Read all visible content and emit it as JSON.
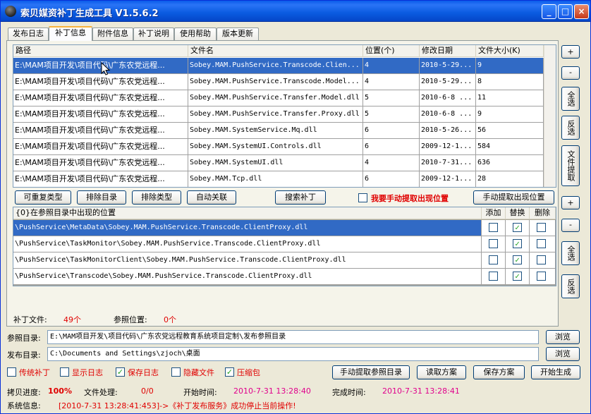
{
  "window": {
    "title": "索贝媒资补丁生成工具 V1.5.6.2",
    "min": "_",
    "max": "□",
    "close": "×"
  },
  "tabs": [
    "发布日志",
    "补丁信息",
    "附件信息",
    "补丁说明",
    "使用帮助",
    "版本更新"
  ],
  "patch_table": {
    "headers": [
      "路径",
      "文件名",
      "位置(个)",
      "修改日期",
      "文件大小(K)"
    ],
    "rows": [
      [
        "E:\\MAM项目开发\\项目代码\\广东农党远程...",
        "Sobey.MAM.PushService.Transcode.Clien...",
        "4",
        "2010-5-29...",
        "9"
      ],
      [
        "E:\\MAM项目开发\\项目代码\\广东农党远程...",
        "Sobey.MAM.PushService.Transcode.Model...",
        "4",
        "2010-5-29...",
        "8"
      ],
      [
        "E:\\MAM项目开发\\项目代码\\广东农党远程...",
        "Sobey.MAM.PushService.Transfer.Model.dll",
        "5",
        "2010-6-8  ...",
        "11"
      ],
      [
        "E:\\MAM项目开发\\项目代码\\广东农党远程...",
        "Sobey.MAM.PushService.Transfer.Proxy.dll",
        "5",
        "2010-6-8  ...",
        "9"
      ],
      [
        "E:\\MAM项目开发\\项目代码\\广东农党远程...",
        "Sobey.MAM.SystemService.Mq.dll",
        "6",
        "2010-5-26...",
        "56"
      ],
      [
        "E:\\MAM项目开发\\项目代码\\广东农党远程...",
        "Sobey.MAM.SystemUI.Controls.dll",
        "6",
        "2009-12-1...",
        "584"
      ],
      [
        "E:\\MAM项目开发\\项目代码\\广东农党远程...",
        "Sobey.MAM.SystemUI.dll",
        "4",
        "2010-7-31...",
        "636"
      ],
      [
        "E:\\MAM项目开发\\项目代码\\广东农党远程...",
        "Sobey.MAM.Tcp.dll",
        "6",
        "2009-12-1...",
        "28"
      ]
    ]
  },
  "right_buttons_top": {
    "plus": "+",
    "minus": "-",
    "select_all": "全选",
    "invert": "反选",
    "extract": "文件提取"
  },
  "mid_buttons": {
    "repeatable_type": "可重复类型",
    "exclude_dir": "排除目录",
    "exclude_type": "排除类型",
    "auto_link": "自动关联",
    "search_patch": "搜索补丁",
    "manual_label": "我要手动提取出现位置",
    "manual_extract": "手动提取出现位置"
  },
  "loc_table": {
    "headers": [
      "{0}在参照目录中出现的位置",
      "添加",
      "替换",
      "删除"
    ],
    "rows": [
      {
        "path": "\\PushService\\MetaData\\Sobey.MAM.PushService.Transcode.ClientProxy.dll",
        "add": false,
        "replace": true,
        "del": false
      },
      {
        "path": "\\PushService\\TaskMonitor\\Sobey.MAM.PushService.Transcode.ClientProxy.dll",
        "add": false,
        "replace": true,
        "del": false
      },
      {
        "path": "\\PushService\\TaskMonitorClient\\Sobey.MAM.PushService.Transcode.ClientProxy.dll",
        "add": false,
        "replace": true,
        "del": false
      },
      {
        "path": "\\PushService\\Transcode\\Sobey.MAM.PushService.Transcode.ClientProxy.dll",
        "add": false,
        "replace": true,
        "del": false
      }
    ]
  },
  "right_buttons_bottom": {
    "plus": "+",
    "minus": "-",
    "select_all": "全选",
    "invert": "反选"
  },
  "counts": {
    "patch_files_label": "补丁文件:",
    "patch_files_value": "49个",
    "ref_pos_label": "参照位置:",
    "ref_pos_value": "0个"
  },
  "ref_dir": {
    "label": "参照目录:",
    "value": "E:\\MAM项目开发\\项目代码\\广东农党远程教育系统项目定制\\发布参照目录",
    "browse": "浏览"
  },
  "pub_dir": {
    "label": "发布目录:",
    "value": "C:\\Documents and Settings\\zjoch\\桌面",
    "browse": "浏览"
  },
  "options": [
    {
      "label": "传统补丁",
      "checked": false
    },
    {
      "label": "显示日志",
      "checked": false
    },
    {
      "label": "保存日志",
      "checked": true
    },
    {
      "label": "隐藏文件",
      "checked": false
    },
    {
      "label": "压缩包",
      "checked": true
    }
  ],
  "action_buttons": {
    "manual_ref": "手动提取参照目录",
    "read_plan": "读取方案",
    "save_plan": "保存方案",
    "start": "开始生成"
  },
  "status": {
    "copy_label": "拷贝进度:",
    "copy_value": "100%",
    "file_label": "文件处理:",
    "file_value": "0/0",
    "start_label": "开始时间:",
    "start_value": "2010-7-31  13:28:40",
    "end_label": "完成时间:",
    "end_value": "2010-7-31  13:28:41",
    "sys_label": "系统信息:",
    "sys_value": "[2010-7-31 13:28:41:453]->《补丁发布服务》成功停止当前操作!"
  },
  "colors": {
    "title_bar": "#0A5CEA",
    "selection": "#316AC5",
    "red_text": "#E00000",
    "magenta_text": "#E0008C"
  }
}
